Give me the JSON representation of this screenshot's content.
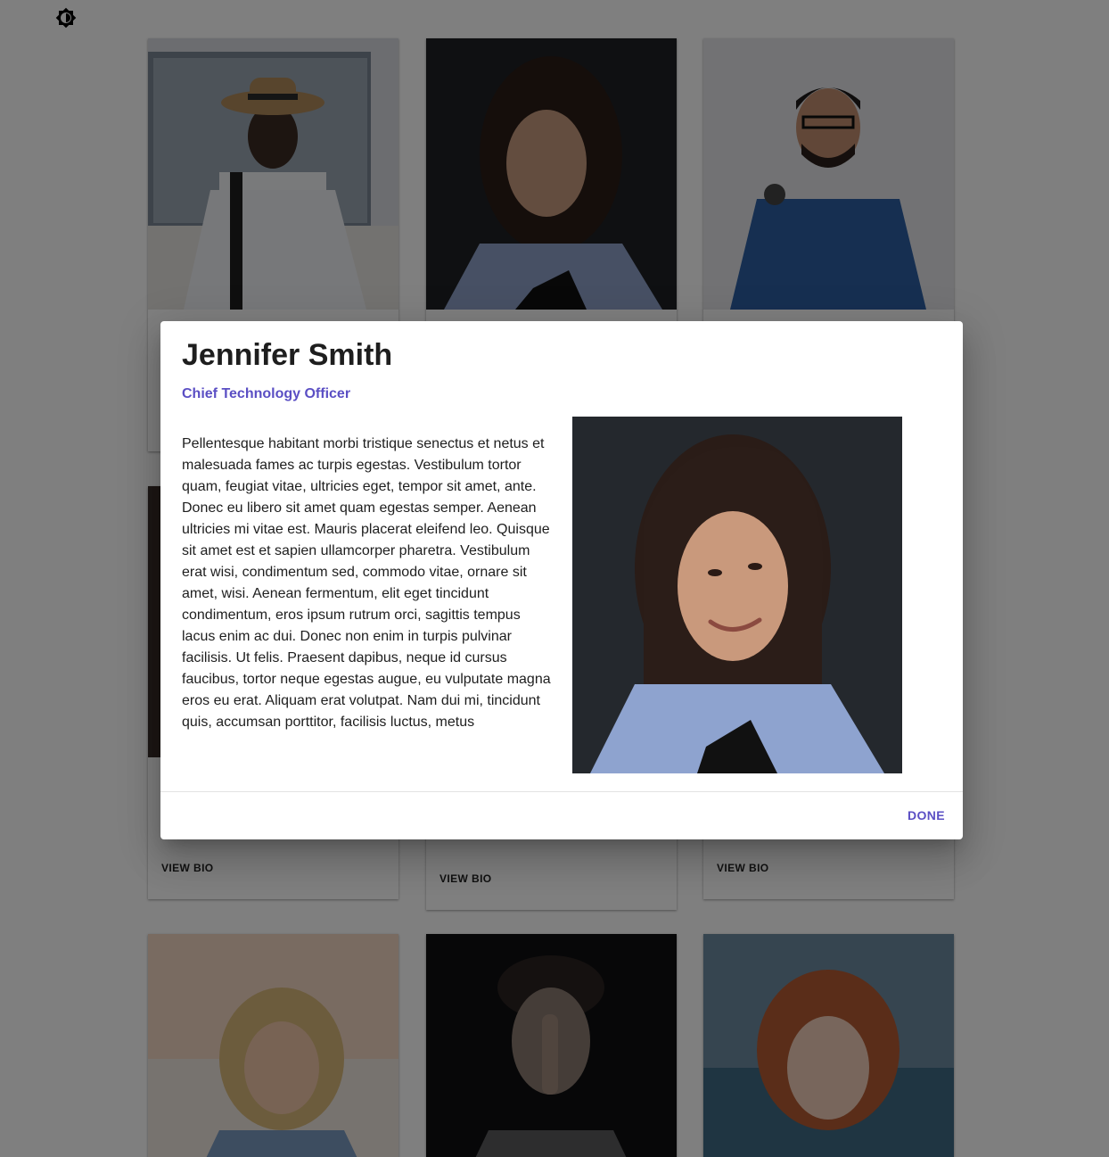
{
  "page": {
    "theme_toggle_icon": "brightness-icon"
  },
  "cards": [
    {
      "view_bio_label": "VIEW BIO"
    },
    {
      "view_bio_label": "VIEW BIO"
    },
    {
      "view_bio_label": "VIEW BIO"
    }
  ],
  "dialog": {
    "name": "Jennifer Smith",
    "title": "Chief Technology Officer",
    "bio": "Pellentesque habitant morbi tristique senectus et netus et malesuada fames ac turpis egestas. Vestibulum tortor quam, feugiat vitae, ultricies eget, tempor sit amet, ante. Donec eu libero sit amet quam egestas semper. Aenean ultricies mi vitae est. Mauris placerat eleifend leo. Quisque sit amet est et sapien ullamcorper pharetra. Vestibulum erat wisi, condimentum sed, commodo vitae, ornare sit amet, wisi. Aenean fermentum, elit eget tincidunt condimentum, eros ipsum rutrum orci, sagittis tempus lacus enim ac dui. Donec non enim in turpis pulvinar facilisis. Ut felis. Praesent dapibus, neque id cursus faucibus, tortor neque egestas augue, eu vulputate magna eros eu erat. Aliquam erat volutpat. Nam dui mi, tincidunt quis, accumsan porttitor, facilisis luctus, metus",
    "done_label": "DONE"
  },
  "colors": {
    "accent": "#5b4fc4",
    "scrim": "rgba(0,0,0,0.5)"
  }
}
